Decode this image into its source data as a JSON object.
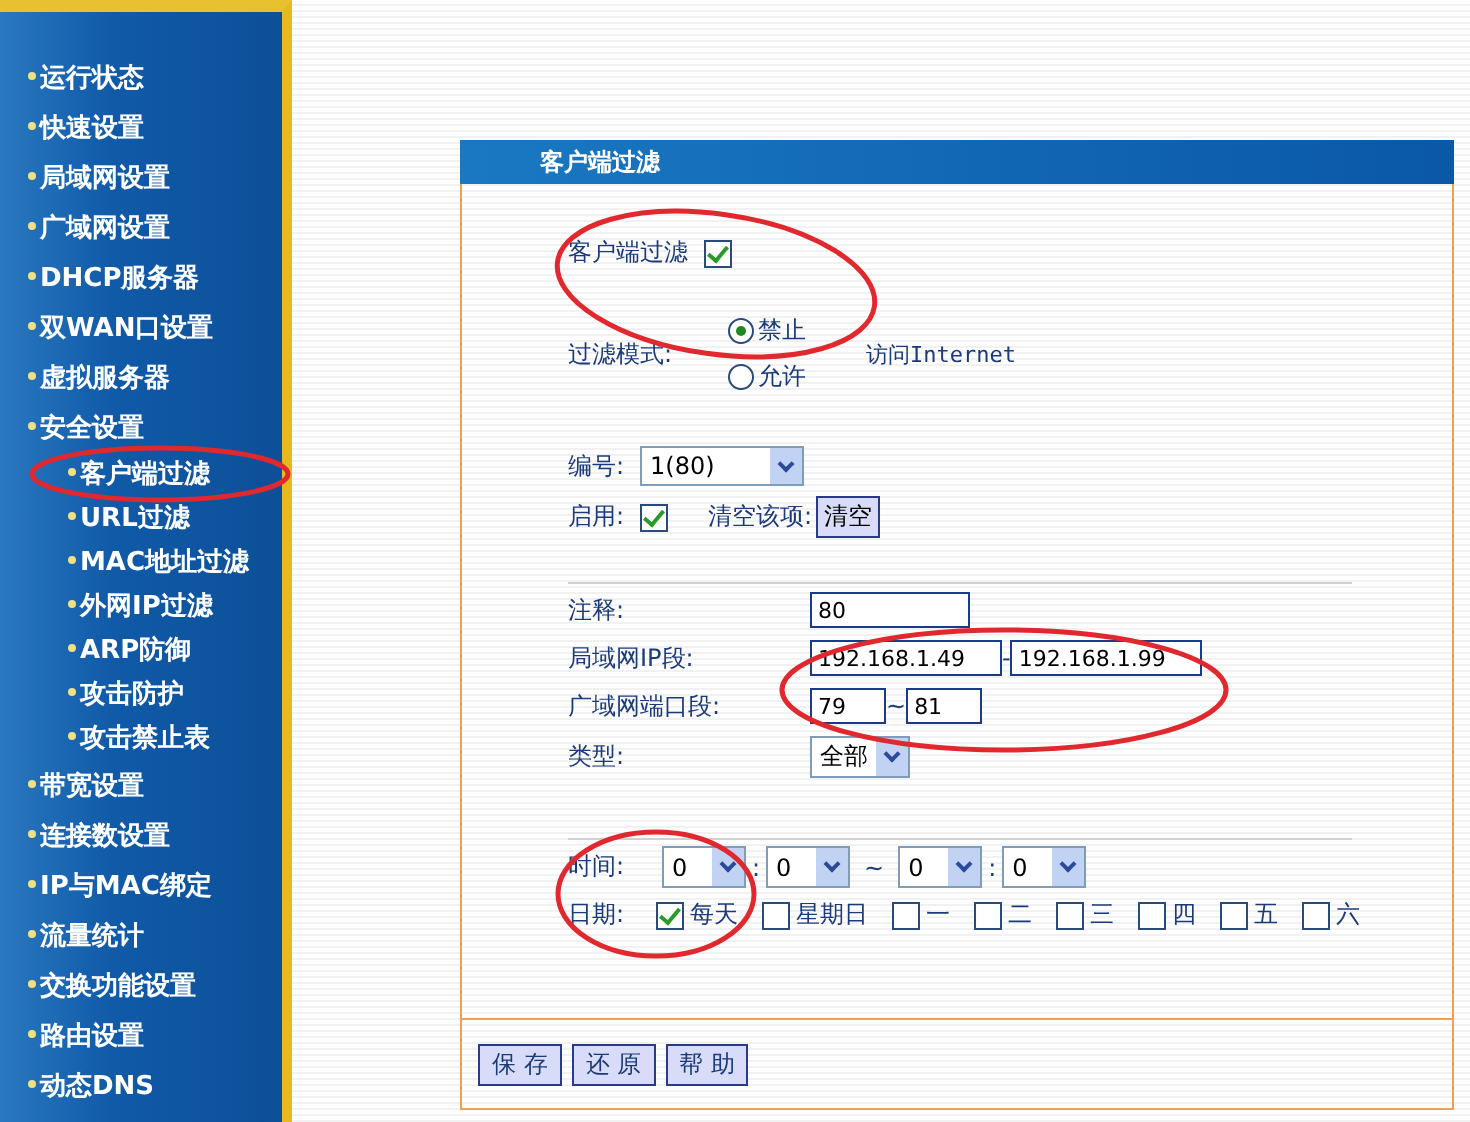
{
  "sidebar": {
    "items": [
      {
        "label": "运行状态"
      },
      {
        "label": "快速设置"
      },
      {
        "label": "局域网设置"
      },
      {
        "label": "广域网设置"
      },
      {
        "label": "DHCP服务器"
      },
      {
        "label": "双WAN口设置"
      },
      {
        "label": "虚拟服务器"
      },
      {
        "label": "安全设置",
        "children": [
          {
            "label": "客户端过滤"
          },
          {
            "label": "URL过滤"
          },
          {
            "label": "MAC地址过滤"
          },
          {
            "label": "外网IP过滤"
          },
          {
            "label": "ARP防御"
          },
          {
            "label": "攻击防护"
          },
          {
            "label": "攻击禁止表"
          }
        ]
      },
      {
        "label": "带宽设置"
      },
      {
        "label": "连接数设置"
      },
      {
        "label": "IP与MAC绑定"
      },
      {
        "label": "流量统计"
      },
      {
        "label": "交换功能设置"
      },
      {
        "label": "路由设置"
      },
      {
        "label": "动态DNS"
      }
    ]
  },
  "panel": {
    "title": "客户端过滤",
    "filter_enable": {
      "label": "客户端过滤",
      "checked": true
    },
    "mode": {
      "label": "过滤模式:",
      "options": [
        {
          "label": "禁止",
          "selected": true
        },
        {
          "label": "允许",
          "selected": false
        }
      ],
      "suffix": "访问Internet"
    },
    "number": {
      "label": "编号:",
      "value": "1(80)"
    },
    "enabled": {
      "label": "启用:",
      "checked": true
    },
    "clear": {
      "label": "清空该项:",
      "button": "清空"
    },
    "comment": {
      "label": "注释:",
      "value": "80"
    },
    "lan_ip": {
      "label": "局域网IP段:",
      "from": "192.168.1.49",
      "separator": "-",
      "to": "192.168.1.99"
    },
    "wan_port": {
      "label": "广域网端口段:",
      "from": "79",
      "separator": "~",
      "to": "81"
    },
    "type": {
      "label": "类型:",
      "value": "全部"
    },
    "time": {
      "label": "时间:",
      "start_hour": "0",
      "start_sep": ":",
      "start_minute": "0",
      "range_sep": "~",
      "end_hour": "0",
      "end_sep": ":",
      "end_minute": "0"
    },
    "date": {
      "label": "日期:",
      "days": [
        {
          "label": "每天",
          "checked": true
        },
        {
          "label": "星期日",
          "checked": false
        },
        {
          "label": "一",
          "checked": false
        },
        {
          "label": "二",
          "checked": false
        },
        {
          "label": "三",
          "checked": false
        },
        {
          "label": "四",
          "checked": false
        },
        {
          "label": "五",
          "checked": false
        },
        {
          "label": "六",
          "checked": false
        }
      ]
    },
    "buttons": [
      "保 存",
      "还 原",
      "帮 助"
    ]
  }
}
